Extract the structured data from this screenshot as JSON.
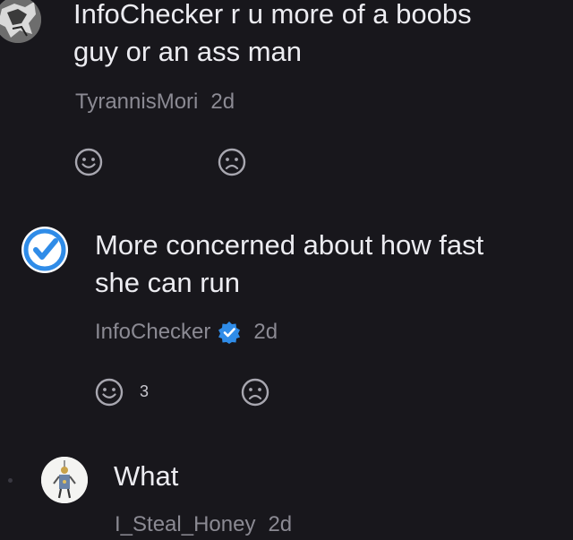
{
  "comments": [
    {
      "text_line1": "InfoChecker r u more of a boobs",
      "text_line2": "guy or an ass man",
      "author": "TyrannisMori",
      "time": "2d",
      "like_count": "",
      "avatar_icon": "user-avatar-sketch-icon"
    },
    {
      "text_line1": "More concerned about how fast",
      "text_line2": "she can run",
      "author": "InfoChecker",
      "time": "2d",
      "like_count": "3",
      "avatar_icon": "verified-check-icon",
      "verified": true
    },
    {
      "text_line1": "What",
      "author": "I_Steal_Honey",
      "time": "2d",
      "avatar_icon": "user-avatar-figure-icon"
    }
  ],
  "colors": {
    "background": "#18171c",
    "text": "#ececf1",
    "meta": "#8b8a93",
    "reaction_icon": "#a8a7b0",
    "verified_blue": "#2f8ce8"
  }
}
